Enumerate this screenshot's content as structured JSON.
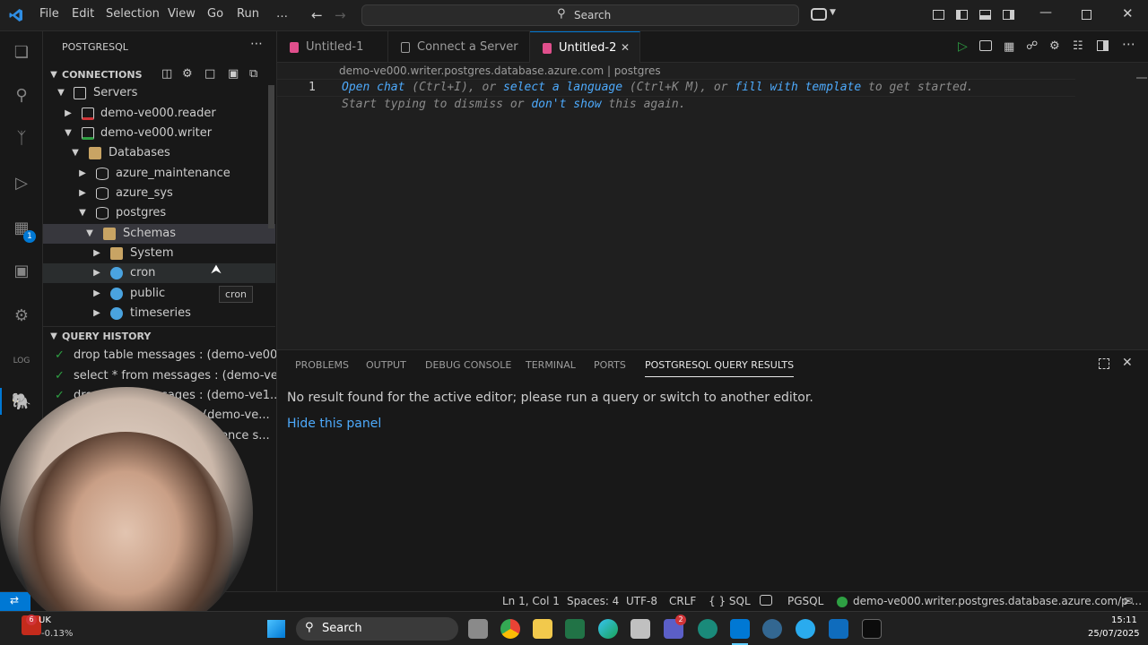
{
  "menu": [
    "File",
    "Edit",
    "Selection",
    "View",
    "Go",
    "Run",
    "…"
  ],
  "search": {
    "label": "Search"
  },
  "sidebar": {
    "title": "POSTGRESQL",
    "connections_label": "CONNECTIONS",
    "tree": [
      {
        "label": "Servers"
      },
      {
        "label": "demo-ve000.reader"
      },
      {
        "label": "demo-ve000.writer"
      },
      {
        "label": "Databases"
      },
      {
        "label": "azure_maintenance"
      },
      {
        "label": "azure_sys"
      },
      {
        "label": "postgres"
      },
      {
        "label": "Schemas"
      },
      {
        "label": "System"
      },
      {
        "label": "cron"
      },
      {
        "label": "public"
      },
      {
        "label": "timeseries"
      }
    ],
    "tooltip": "cron",
    "history_label": "QUERY HISTORY",
    "history": [
      "drop table messages : (demo-ve00...",
      "select * from messages : (demo-ve...",
      "drop table messages : (demo-ve1...",
      "(demo-ve...",
      "ence s..."
    ]
  },
  "tabs": [
    {
      "label": "Untitled-1"
    },
    {
      "label": "Connect a Server"
    },
    {
      "label": "Untitled-2"
    }
  ],
  "editor": {
    "breadcrumb": "demo-ve000.writer.postgres.database.azure.com | postgres",
    "line_number": "1",
    "hint_open_chat": "Open chat",
    "hint_open_chat_key": "(Ctrl+I), or",
    "hint_select_language": "select a language",
    "hint_select_key": "(Ctrl+K M), or",
    "hint_fill": "fill with template",
    "hint_end": "to get started.",
    "hint2_a": "Start typing to dismiss or",
    "hint2_link": "don't show",
    "hint2_b": "this again."
  },
  "panel": {
    "tabs": [
      "PROBLEMS",
      "OUTPUT",
      "DEBUG CONSOLE",
      "TERMINAL",
      "PORTS",
      "POSTGRESQL QUERY RESULTS"
    ],
    "message": "No result found for the active editor; please run a query or switch to another editor.",
    "hide_link": "Hide this panel"
  },
  "status": {
    "position": "Ln 1, Col 1",
    "spaces": "Spaces: 4",
    "encoding": "UTF-8",
    "eol": "CRLF",
    "language": "{ } SQL",
    "pgsql": "PGSQL",
    "connection": "demo-ve000.writer.postgres.database.azure.com/p ..."
  },
  "taskbar": {
    "search": "Search",
    "time": "15:11",
    "date": "25/07/2025",
    "stock_name": "UK",
    "stock_change": "-0.13%",
    "badge_left": "6",
    "badge_teams": "2"
  },
  "colors": {
    "accent": "#0078d4",
    "link": "#4daafc",
    "success": "#2ea043"
  }
}
